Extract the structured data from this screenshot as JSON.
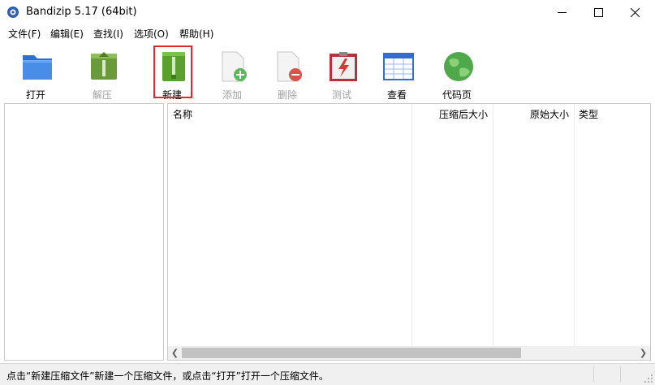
{
  "window": {
    "title": "Bandizip 5.17 (64bit)"
  },
  "menu": [
    "文件(F)",
    "编辑(E)",
    "查找(I)",
    "选项(O)",
    "帮助(H)"
  ],
  "toolbar": {
    "open": "打开",
    "extract": "解压",
    "new": "新建",
    "add": "添加",
    "delete": "删除",
    "test": "测试",
    "view": "查看",
    "codepage": "代码页"
  },
  "file_list": {
    "columns": {
      "name": "名称",
      "compressed": "压缩后大小",
      "original": "原始大小",
      "type": "类型"
    }
  },
  "status": {
    "text": "点击“新建压缩文件”新建一个压缩文件，或点击“打开”打开一个压缩文件。"
  },
  "colors": {
    "highlight": "#e0292b",
    "accent_green": "#5aa02c",
    "accent_blue": "#2f6fd0"
  },
  "icons": [
    "app-icon",
    "open-icon",
    "extract-icon",
    "new-archive-icon",
    "add-icon",
    "delete-icon",
    "test-icon",
    "view-icon",
    "codepage-icon"
  ]
}
